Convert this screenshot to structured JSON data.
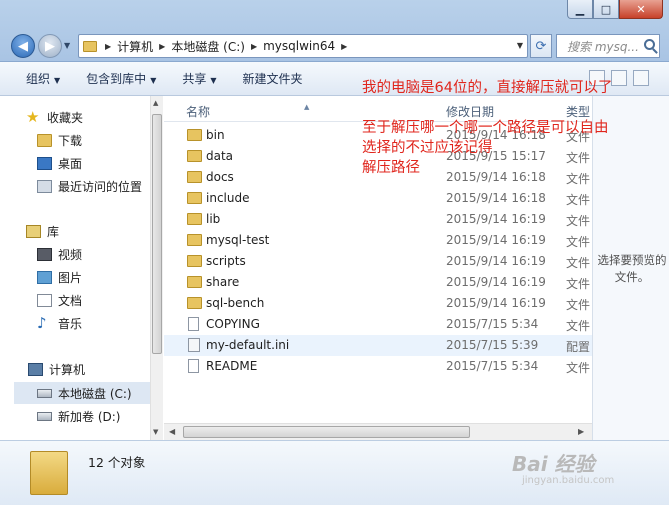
{
  "window": {
    "min_symbol": "▁",
    "max_symbol": "□",
    "close_symbol": "✕"
  },
  "address": {
    "crumbs": [
      "计算机",
      "本地磁盘 (C:)",
      "mysqlwin64"
    ],
    "search_placeholder": "搜索 mysq..."
  },
  "toolbar": {
    "organize": "组织",
    "include": "包含到库中",
    "share": "共享",
    "new_folder": "新建文件夹"
  },
  "sidebar": {
    "favorites": "收藏夹",
    "downloads": "下载",
    "desktop": "桌面",
    "recent": "最近访问的位置",
    "libraries": "库",
    "videos": "视频",
    "pictures": "图片",
    "documents": "文档",
    "music": "音乐",
    "computer": "计算机",
    "local_disk": "本地磁盘 (C:)",
    "new_volume": "新加卷 (D:)"
  },
  "columns": {
    "name": "名称",
    "date": "修改日期",
    "type": "类型"
  },
  "files": [
    {
      "name": "bin",
      "date": "2015/9/14 16:18",
      "type": "文件",
      "kind": "folder"
    },
    {
      "name": "data",
      "date": "2015/9/15 15:17",
      "type": "文件",
      "kind": "folder"
    },
    {
      "name": "docs",
      "date": "2015/9/14 16:18",
      "type": "文件",
      "kind": "folder"
    },
    {
      "name": "include",
      "date": "2015/9/14 16:18",
      "type": "文件",
      "kind": "folder"
    },
    {
      "name": "lib",
      "date": "2015/9/14 16:19",
      "type": "文件",
      "kind": "folder"
    },
    {
      "name": "mysql-test",
      "date": "2015/9/14 16:19",
      "type": "文件",
      "kind": "folder"
    },
    {
      "name": "scripts",
      "date": "2015/9/14 16:19",
      "type": "文件",
      "kind": "folder"
    },
    {
      "name": "share",
      "date": "2015/9/14 16:19",
      "type": "文件",
      "kind": "folder"
    },
    {
      "name": "sql-bench",
      "date": "2015/9/14 16:19",
      "type": "文件",
      "kind": "folder"
    },
    {
      "name": "COPYING",
      "date": "2015/7/15 5:34",
      "type": "文件",
      "kind": "file"
    },
    {
      "name": "my-default.ini",
      "date": "2015/7/15 5:39",
      "type": "配置",
      "kind": "config"
    },
    {
      "name": "README",
      "date": "2015/7/15 5:34",
      "type": "文件",
      "kind": "file"
    }
  ],
  "preview": {
    "text": "选择要预览的文件。"
  },
  "annotations": {
    "line1": "我的电脑是64位的，直接解压就可以了",
    "line2": "至于解压哪一个哪一个路径是可以自由",
    "line3": "选择的不过应该记得",
    "line4": "解压路径"
  },
  "status": {
    "count": "12 个对象"
  },
  "watermark": {
    "brand": "Bai 经验",
    "url": "jingyan.baidu.com"
  },
  "colors": {
    "annotation": "#e0261d",
    "folder": "#e7c460"
  }
}
